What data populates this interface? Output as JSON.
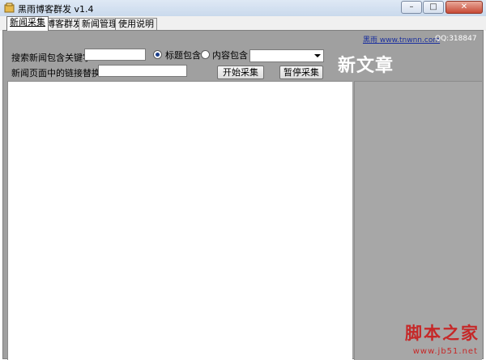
{
  "window": {
    "title": "黑雨博客群发 v1.4",
    "icon": "app-icon",
    "minimize_glyph": "–",
    "maximize_glyph": "□",
    "close_glyph": "✕"
  },
  "tabs": [
    {
      "label": "新闻采集",
      "active": true
    },
    {
      "label": "博客群发",
      "active": false
    },
    {
      "label": "新闻管理",
      "active": false
    },
    {
      "label": "使用说明",
      "active": false
    }
  ],
  "header": {
    "link_label": "黑雨",
    "link_url_text": "www.tnwnn.com",
    "qq_text": "QQ:318847",
    "big_title": "新文章"
  },
  "form": {
    "keyword_label": "搜索新闻包含关键字",
    "keyword_value": "",
    "radio_title_label": "标题包含",
    "radio_title_checked": true,
    "radio_content_label": "内容包含",
    "radio_content_checked": false,
    "dropdown_value": "",
    "replace_label": "新闻页面中的链接替换为",
    "replace_value": "",
    "start_button": "开始采集",
    "pause_button": "暂停采集"
  },
  "watermark": {
    "text": "脚本之家",
    "url": "www.jb51.net"
  }
}
